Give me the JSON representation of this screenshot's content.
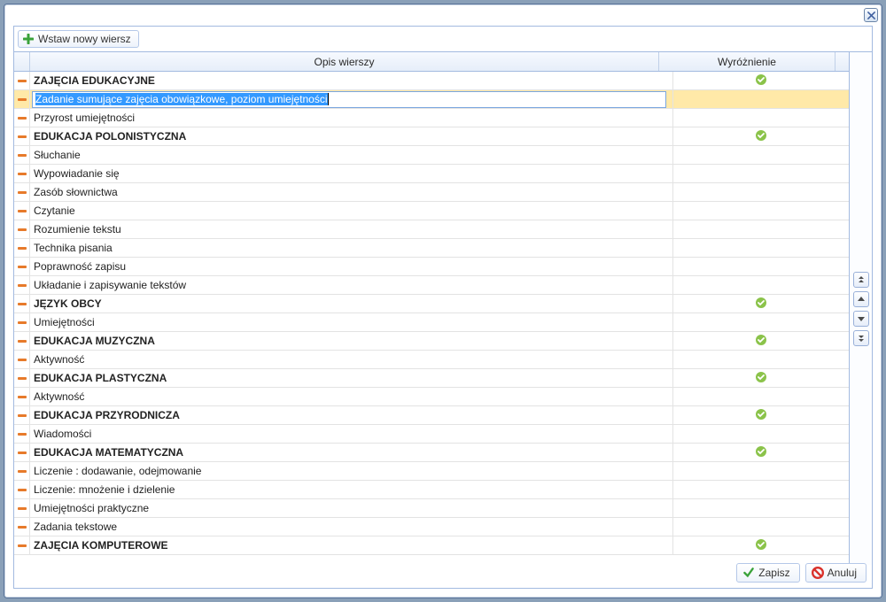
{
  "toolbar": {
    "insert_label": "Wstaw nowy wiersz"
  },
  "header": {
    "desc": "Opis wierszy",
    "mark": "Wyróżnienie"
  },
  "rows": [
    {
      "text": "ZAJĘCIA EDUKACYJNE",
      "bold": true,
      "tick": true
    },
    {
      "text": "Zadanie sumujące zajęcia obowiązkowe, poziom umiejętności",
      "bold": false,
      "tick": false,
      "editing": true
    },
    {
      "text": "Przyrost umiejętności",
      "bold": false,
      "tick": false
    },
    {
      "text": "EDUKACJA POLONISTYCZNA",
      "bold": true,
      "tick": true
    },
    {
      "text": "Słuchanie",
      "bold": false,
      "tick": false
    },
    {
      "text": "Wypowiadanie się",
      "bold": false,
      "tick": false
    },
    {
      "text": "Zasób słownictwa",
      "bold": false,
      "tick": false
    },
    {
      "text": "Czytanie",
      "bold": false,
      "tick": false
    },
    {
      "text": "Rozumienie tekstu",
      "bold": false,
      "tick": false
    },
    {
      "text": "Technika pisania",
      "bold": false,
      "tick": false
    },
    {
      "text": "Poprawność zapisu",
      "bold": false,
      "tick": false
    },
    {
      "text": "Układanie i zapisywanie tekstów",
      "bold": false,
      "tick": false
    },
    {
      "text": "JĘZYK OBCY",
      "bold": true,
      "tick": true
    },
    {
      "text": "Umiejętności",
      "bold": false,
      "tick": false
    },
    {
      "text": "EDUKACJA MUZYCZNA",
      "bold": true,
      "tick": true
    },
    {
      "text": "Aktywność",
      "bold": false,
      "tick": false
    },
    {
      "text": "EDUKACJA PLASTYCZNA",
      "bold": true,
      "tick": true
    },
    {
      "text": "Aktywność",
      "bold": false,
      "tick": false
    },
    {
      "text": "EDUKACJA PRZYRODNICZA",
      "bold": true,
      "tick": true
    },
    {
      "text": "Wiadomości",
      "bold": false,
      "tick": false
    },
    {
      "text": "EDUKACJA MATEMATYCZNA",
      "bold": true,
      "tick": true
    },
    {
      "text": "Liczenie : dodawanie, odejmowanie",
      "bold": false,
      "tick": false
    },
    {
      "text": "Liczenie: mnożenie i dzielenie",
      "bold": false,
      "tick": false
    },
    {
      "text": "Umiejętności praktyczne",
      "bold": false,
      "tick": false
    },
    {
      "text": "Zadania tekstowe",
      "bold": false,
      "tick": false
    },
    {
      "text": "ZAJĘCIA KOMPUTEROWE",
      "bold": true,
      "tick": true
    }
  ],
  "footer": {
    "save": "Zapisz",
    "cancel": "Anuluj"
  },
  "icons": {
    "close": "✕",
    "plus": "+",
    "tick": "✓"
  }
}
